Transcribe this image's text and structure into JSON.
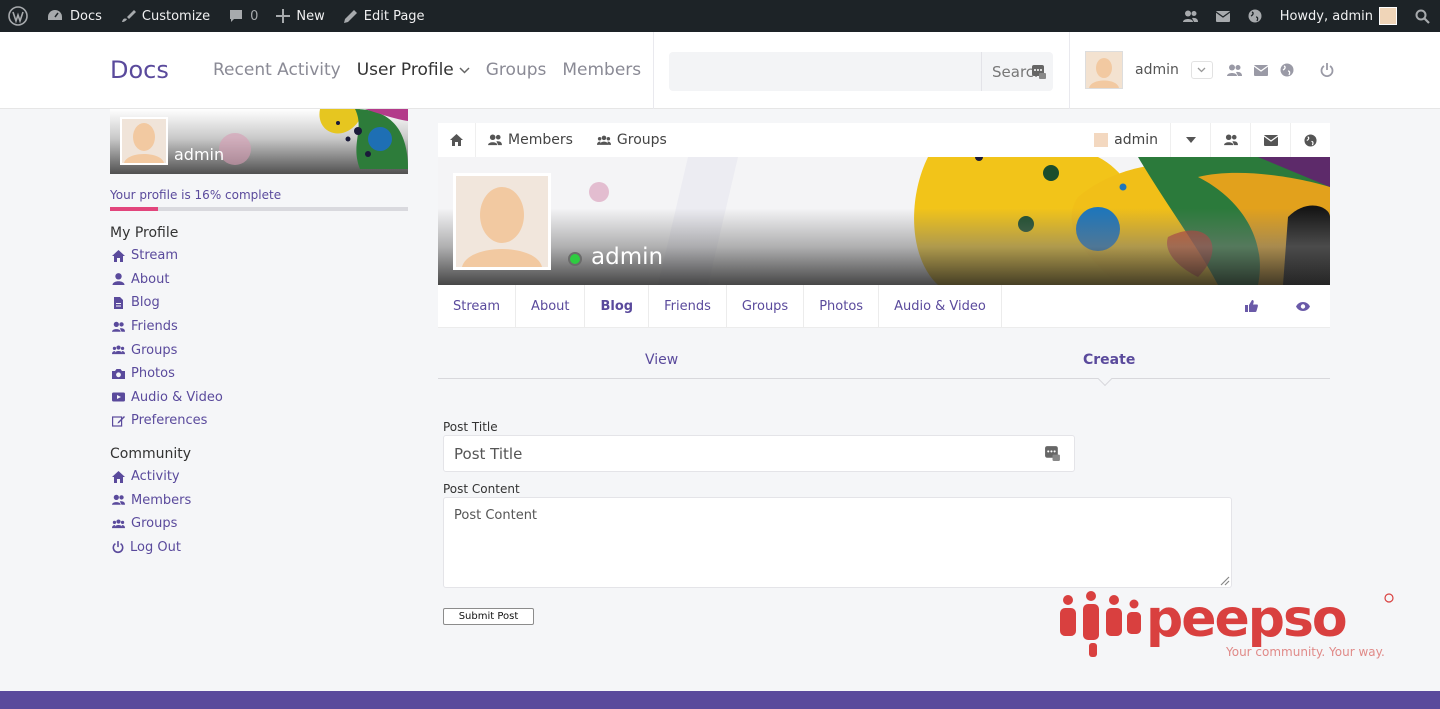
{
  "admin_bar": {
    "site_name": "Docs",
    "customize": "Customize",
    "comments_count": "0",
    "new": "New",
    "edit_page": "Edit Page",
    "howdy": "Howdy, admin"
  },
  "header": {
    "brand": "Docs",
    "nav": [
      "Recent Activity",
      "User Profile",
      "Groups",
      "Members"
    ],
    "search_button": "Search",
    "user_name": "admin"
  },
  "sidebar": {
    "cover_name": "admin",
    "profile_completion_text": "Your profile is 16% complete",
    "profile_completion_percent": 16,
    "my_profile_heading": "My Profile",
    "my_profile_items": [
      "Stream",
      "About",
      "Blog",
      "Friends",
      "Groups",
      "Photos",
      "Audio & Video",
      "Preferences"
    ],
    "community_heading": "Community",
    "community_items": [
      "Activity",
      "Members",
      "Groups",
      "Log Out"
    ]
  },
  "focus_bar": {
    "members": "Members",
    "groups": "Groups",
    "user": "admin"
  },
  "profile": {
    "name": "admin",
    "tabs": [
      "Stream",
      "About",
      "Blog",
      "Friends",
      "Groups",
      "Photos",
      "Audio & Video"
    ],
    "active_tab": "Blog"
  },
  "blog": {
    "subtab_view": "View",
    "subtab_create": "Create",
    "post_title_label": "Post Title",
    "post_title_placeholder": "Post Title",
    "post_content_label": "Post Content",
    "post_content_placeholder": "Post Content",
    "submit_label": "Submit Post"
  },
  "branding": {
    "logo_text": "peepso",
    "tagline": "Your community. Your way."
  },
  "colors": {
    "accent": "#5a4a9c",
    "admin_bar": "#1d2327",
    "progress": "#e2457c",
    "online": "#2ecc40",
    "logo": "#d9403f"
  }
}
